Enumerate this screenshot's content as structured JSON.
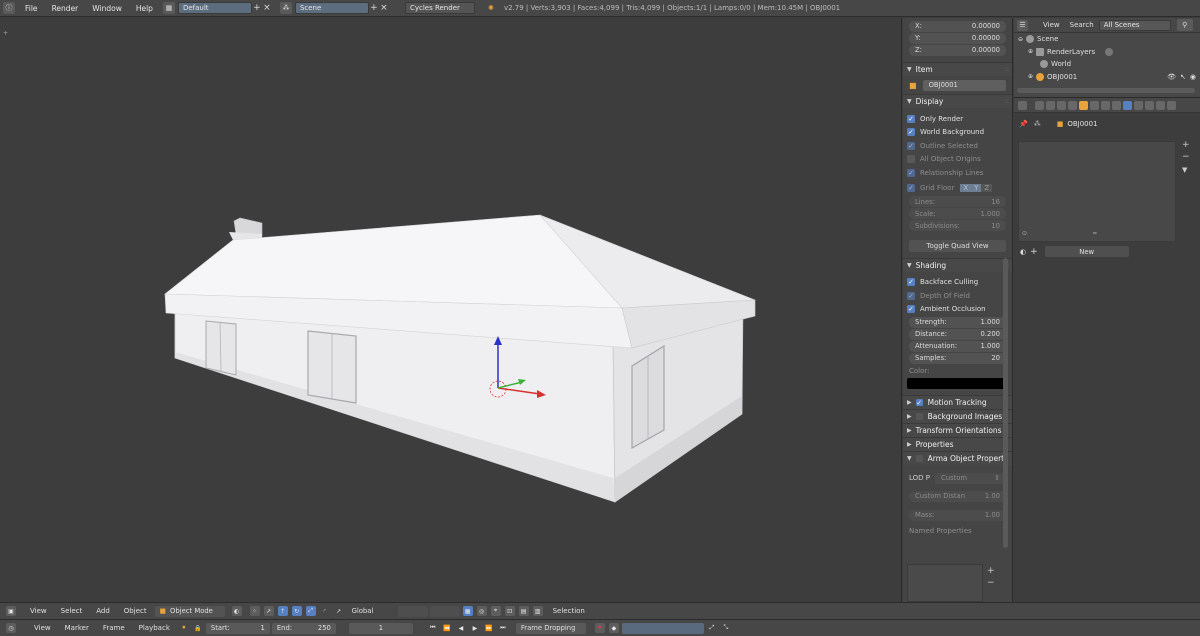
{
  "topbar": {
    "menus": [
      "File",
      "Render",
      "Window",
      "Help"
    ],
    "screen_layout": "Default",
    "scene": "Scene",
    "render_engine": "Cycles Render",
    "stats": "v2.79 | Verts:3,903 | Faces:4,099 | Tris:4,099 | Objects:1/1 | Lamps:0/0 | Mem:10.45M | OBJ0001"
  },
  "npanel": {
    "coords": [
      {
        "label": "X:",
        "value": "0.00000"
      },
      {
        "label": "Y:",
        "value": "0.00000"
      },
      {
        "label": "Z:",
        "value": "0.00000"
      }
    ],
    "item_header": "Item",
    "object_name": "OBJ0001",
    "display_header": "Display",
    "display_checks": [
      {
        "label": "Only Render",
        "checked": true,
        "dim": false
      },
      {
        "label": "World Background",
        "checked": true,
        "dim": false
      },
      {
        "label": "Outline Selected",
        "checked": true,
        "dim": true
      },
      {
        "label": "All Object Origins",
        "checked": false,
        "dim": true
      },
      {
        "label": "Relationship Lines",
        "checked": true,
        "dim": true
      }
    ],
    "grid_floor_label": "Grid Floor",
    "grid_axes": [
      "X",
      "Y",
      "Z"
    ],
    "grid_fields": [
      {
        "label": "Lines:",
        "value": "16"
      },
      {
        "label": "Scale:",
        "value": "1.000"
      },
      {
        "label": "Subdivisions:",
        "value": "10"
      }
    ],
    "toggle_quad_view": "Toggle Quad View",
    "shading_header": "Shading",
    "shading_checks": [
      {
        "label": "Backface Culling",
        "checked": true,
        "dim": false
      },
      {
        "label": "Depth Of Field",
        "checked": true,
        "dim": true
      },
      {
        "label": "Ambient Occlusion",
        "checked": true,
        "dim": false
      }
    ],
    "ao_fields": [
      {
        "label": "Strength:",
        "value": "1.000"
      },
      {
        "label": "Distance:",
        "value": "0.200"
      },
      {
        "label": "Attenuation:",
        "value": "1.000"
      },
      {
        "label": "Samples:",
        "value": "20"
      }
    ],
    "color_label": "Color:",
    "color_value": "#000000",
    "collapsed_panels": [
      {
        "label": "Motion Tracking",
        "checkbox": true
      },
      {
        "label": "Background Images",
        "checkbox": true
      },
      {
        "label": "Transform Orientations",
        "checkbox": false
      },
      {
        "label": "Properties",
        "checkbox": false
      }
    ],
    "arma_header": "Arma Object Properti",
    "lod_label": "LOD P",
    "lod_value": "Custom",
    "custom_distance_label": "Custom Distan",
    "custom_distance_value": "1.00",
    "mass_label": "Mass:",
    "mass_value": "1.00",
    "named_properties": "Named Properties"
  },
  "outliner": {
    "menus": [
      "View",
      "Search"
    ],
    "filter": "All Scenes",
    "items": [
      {
        "label": "Scene",
        "indent": 0
      },
      {
        "label": "RenderLayers",
        "indent": 1
      },
      {
        "label": "World",
        "indent": 1
      },
      {
        "label": "OBJ0001",
        "indent": 1
      }
    ]
  },
  "properties": {
    "object_name": "OBJ0001",
    "new_label": "New"
  },
  "viewport_header": {
    "menus": [
      "View",
      "Select",
      "Add",
      "Object"
    ],
    "mode": "Object Mode",
    "orientation": "Global",
    "selection": "Selection"
  },
  "timeline": {
    "menus": [
      "View",
      "Marker",
      "Frame",
      "Playback"
    ],
    "start_label": "Start:",
    "start_value": "1",
    "end_label": "End:",
    "end_value": "250",
    "current_frame": "1",
    "sync_mode": "Frame Dropping"
  },
  "colors": {
    "accent": "#5680c2",
    "header": "#474747",
    "viewport": "#3d3d3d",
    "house": "#eeeef0"
  }
}
